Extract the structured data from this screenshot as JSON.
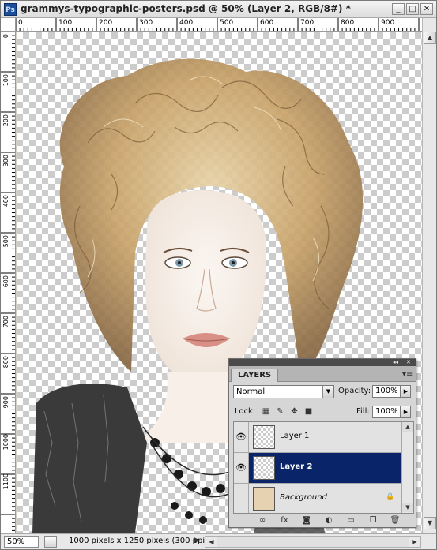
{
  "window": {
    "app_icon": "Ps",
    "title": "grammys-typographic-posters.psd @ 50% (Layer 2, RGB/8#) *",
    "buttons": {
      "minimize": "_",
      "maximize": "□",
      "close": "✕"
    }
  },
  "rulers": {
    "top_labels": [
      "0",
      "100",
      "200",
      "300",
      "400",
      "500",
      "600",
      "700",
      "800",
      "900"
    ],
    "left_labels": [
      "0",
      "100",
      "200",
      "300",
      "400",
      "500",
      "600",
      "700",
      "800",
      "900",
      "1000",
      "1100"
    ]
  },
  "canvas": {
    "description_icon": "layer-artwork",
    "transparency": "checkerboard"
  },
  "status": {
    "zoom": "50%",
    "doc_info": "1000 pixels x 1250 pixels (300 ppi)",
    "arrow": "▶"
  },
  "layers_panel": {
    "tab": "LAYERS",
    "collapse_icon": "◂◂",
    "close_icon": "✕",
    "menu_icon": "▾≡",
    "blend_mode": "Normal",
    "opacity_label": "Opacity:",
    "opacity_value": "100%",
    "lock_label": "Lock:",
    "fill_label": "Fill:",
    "fill_value": "100%",
    "layers": [
      {
        "name": "Layer 1",
        "visible": true,
        "selected": false
      },
      {
        "name": "Layer 2",
        "visible": true,
        "selected": true
      },
      {
        "name": "Background",
        "visible": false,
        "selected": false,
        "locked": true
      }
    ],
    "footer_icons": [
      "link-icon",
      "fx-icon",
      "mask-icon",
      "adjustment-icon",
      "folder-icon",
      "new-layer-icon",
      "trash-icon"
    ]
  },
  "colors": {
    "selected_row": "#0a246a",
    "panel_bg": "#d6d6d6",
    "chrome_bg": "#d4d0c8"
  }
}
